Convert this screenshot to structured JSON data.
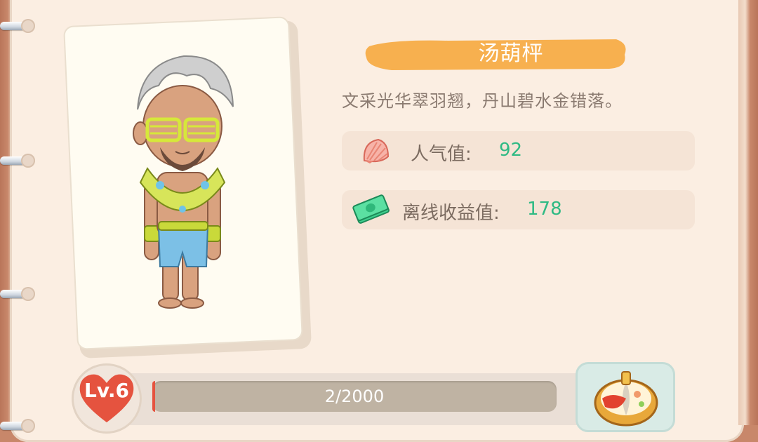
{
  "character": {
    "name": "汤葫枰",
    "description": "文采光华翠羽翘，丹山碧水金错落。"
  },
  "stats": [
    {
      "icon": "shell-icon",
      "label": "人气值:",
      "value": "92"
    },
    {
      "icon": "cash-icon",
      "label": "离线收益值:",
      "value": "178"
    }
  ],
  "level": {
    "label": "Lv.6",
    "progress_text": "2/2000",
    "progress_fraction": 0.001
  },
  "colors": {
    "banner": "#f7b04f",
    "value_green": "#2fba84",
    "heart_red": "#e5533f"
  },
  "icons": {
    "dish": "hotpot-dish-icon"
  }
}
